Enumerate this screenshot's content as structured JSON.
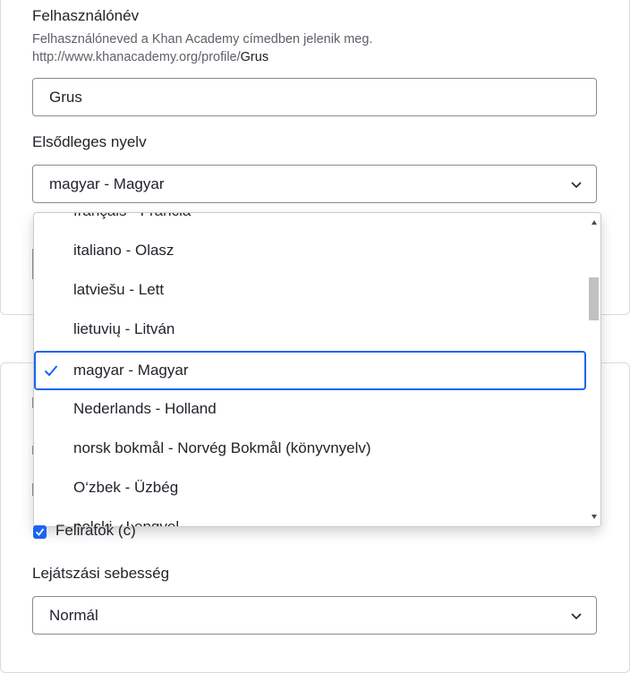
{
  "profile": {
    "username_label": "Felhasználónév",
    "username_hint": "Felhasználóneved a Khan Academy címedben jelenik meg.",
    "profile_url_prefix": "http://www.khanacademy.org/profile/",
    "profile_url_name": "Grus",
    "username_value": "Grus",
    "language_label": "Elsődleges nyelv",
    "language_value": "magyar - Magyar"
  },
  "language_dropdown": {
    "options": [
      "français - Francia",
      "italiano - Olasz",
      "latviešu - Lett",
      "lietuvių - Litván",
      "magyar - Magyar",
      "Nederlands - Holland",
      "norsk bokmål - Norvég Bokmål (könyvnyelv)",
      "O‘zbek - Üzbég",
      "polski - Lengyel"
    ],
    "selected": "magyar - Magyar"
  },
  "video": {
    "captions_label": "Feliratok (c)",
    "captions_checked": true,
    "speed_label": "Lejátszási sebesség",
    "speed_value": "Normál"
  },
  "colors": {
    "accent": "#1865f2",
    "border": "#878a90",
    "text": "#21242c",
    "muted": "#5e6169"
  }
}
